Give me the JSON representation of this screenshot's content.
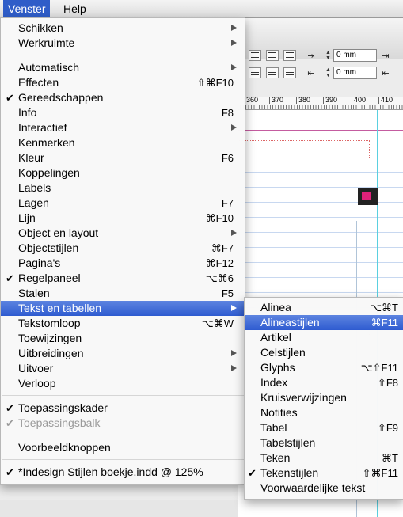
{
  "menubar": {
    "items": [
      "Venster",
      "Help"
    ]
  },
  "venster_menu": {
    "items": [
      {
        "label": "Schikken",
        "arrow": true
      },
      {
        "label": "Werkruimte",
        "arrow": true
      },
      {
        "label": "Automatisch",
        "arrow": true
      },
      {
        "label": "Effecten",
        "shortcut": "⇧⌘F10"
      },
      {
        "label": "Gereedschappen",
        "checked": true
      },
      {
        "label": "Info",
        "shortcut": "F8"
      },
      {
        "label": "Interactief",
        "arrow": true
      },
      {
        "label": "Kenmerken"
      },
      {
        "label": "Kleur",
        "shortcut": "F6"
      },
      {
        "label": "Koppelingen"
      },
      {
        "label": "Labels"
      },
      {
        "label": "Lagen",
        "shortcut": "F7"
      },
      {
        "label": "Lijn",
        "shortcut": "⌘F10"
      },
      {
        "label": "Object en layout",
        "arrow": true
      },
      {
        "label": "Objectstijlen",
        "shortcut": "⌘F7"
      },
      {
        "label": "Pagina's",
        "shortcut": "⌘F12"
      },
      {
        "label": "Regelpaneel",
        "checked": true,
        "shortcut": "⌥⌘6"
      },
      {
        "label": "Stalen",
        "shortcut": "F5"
      },
      {
        "label": "Tekst en tabellen",
        "arrow": true,
        "highlighted": true
      },
      {
        "label": "Tekstomloop",
        "shortcut": "⌥⌘W"
      },
      {
        "label": "Toewijzingen"
      },
      {
        "label": "Uitbreidingen",
        "arrow": true
      },
      {
        "label": "Uitvoer",
        "arrow": true
      },
      {
        "label": "Verloop"
      },
      {
        "label": "Toepassingskader",
        "checked": true
      },
      {
        "label": "Toepassingsbalk",
        "checked": true,
        "disabled": true
      },
      {
        "label": "Voorbeeldknoppen"
      },
      {
        "label": "*Indesign Stijlen boekje.indd @ 125%",
        "checked": true
      }
    ]
  },
  "submenu": {
    "items": [
      {
        "label": "Alinea",
        "shortcut": "⌥⌘T"
      },
      {
        "label": "Alineastijlen",
        "shortcut": "⌘F11",
        "highlighted": true
      },
      {
        "label": "Artikel"
      },
      {
        "label": "Celstijlen"
      },
      {
        "label": "Glyphs",
        "shortcut": "⌥⇧F11"
      },
      {
        "label": "Index",
        "shortcut": "⇧F8"
      },
      {
        "label": "Kruisverwijzingen"
      },
      {
        "label": "Notities"
      },
      {
        "label": "Tabel",
        "shortcut": "⇧F9"
      },
      {
        "label": "Tabelstijlen"
      },
      {
        "label": "Teken",
        "shortcut": "⌘T"
      },
      {
        "label": "Tekenstijlen",
        "checked": true,
        "shortcut": "⇧⌘F11"
      },
      {
        "label": "Voorwaardelijke tekst"
      }
    ]
  },
  "control_panel": {
    "indent_left": "0 mm",
    "indent_first": "0 mm"
  },
  "ruler": {
    "ticks": [
      "360",
      "370",
      "380",
      "390",
      "400",
      "410"
    ]
  },
  "colors": {
    "highlight": "#2e5bd0",
    "menu_bg": "#f8f8f8"
  }
}
